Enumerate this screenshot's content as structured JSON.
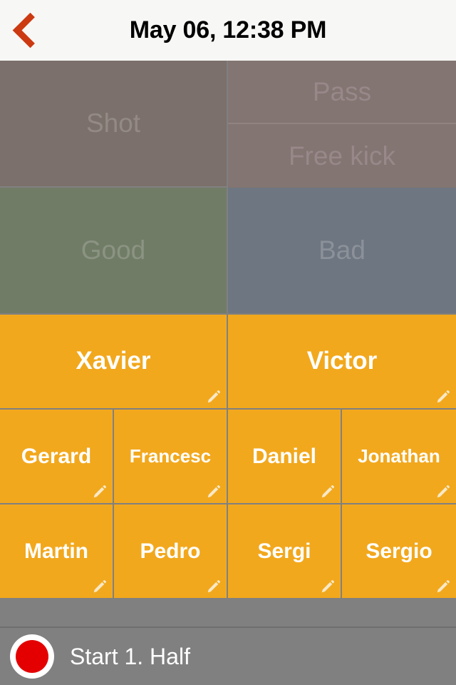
{
  "header": {
    "back_icon": "chevron-left-icon",
    "title": "May 06, 12:38 PM"
  },
  "action_tiles": {
    "shot": {
      "label": "Shot",
      "color": "#7b706b",
      "enabled": false
    },
    "pass": {
      "label": "Pass",
      "color": "#837571",
      "enabled": false
    },
    "free_kick": {
      "label": "Free kick",
      "color": "#837571",
      "enabled": false
    }
  },
  "quality_tiles": {
    "good": {
      "label": "Good",
      "color": "#717c67",
      "enabled": false
    },
    "bad": {
      "label": "Bad",
      "color": "#6e7681",
      "enabled": false
    }
  },
  "players": {
    "tile_color": "#f2a81d",
    "edit_icon": "pencil-icon",
    "rows": [
      {
        "columns": 2,
        "items": [
          {
            "name": "Xavier",
            "size": "lg"
          },
          {
            "name": "Victor",
            "size": "lg"
          }
        ]
      },
      {
        "columns": 4,
        "items": [
          {
            "name": "Gerard",
            "size": "md"
          },
          {
            "name": "Francesc",
            "size": "sm"
          },
          {
            "name": "Daniel",
            "size": "md"
          },
          {
            "name": "Jonathan",
            "size": "sm"
          }
        ]
      },
      {
        "columns": 4,
        "items": [
          {
            "name": "Martin",
            "size": "md"
          },
          {
            "name": "Pedro",
            "size": "md"
          },
          {
            "name": "Sergi",
            "size": "md"
          },
          {
            "name": "Sergio",
            "size": "md"
          }
        ]
      }
    ]
  },
  "action_bar": {
    "record_icon": "record-circle-icon",
    "record_color": "#e40000",
    "label": "Start 1. Half"
  }
}
